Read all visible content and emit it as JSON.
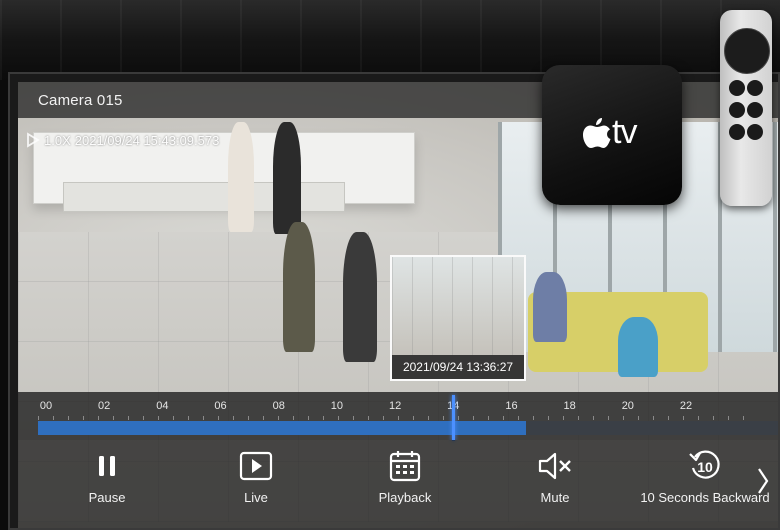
{
  "camera": {
    "title": "Camera 015",
    "osd_speed": "1.0X",
    "osd_timestamp": "2021/09/24 15:43:09.573"
  },
  "preview": {
    "timestamp": "2021/09/24 13:36:27"
  },
  "timeline": {
    "hour_labels": [
      "00",
      "02",
      "04",
      "06",
      "08",
      "10",
      "12",
      "14",
      "16",
      "18",
      "20",
      "22"
    ],
    "recorded_fraction": 0.66,
    "playhead_fraction": 0.56
  },
  "controls": {
    "pause_label": "Pause",
    "live_label": "Live",
    "playback_label": "Playback",
    "mute_label": "Mute",
    "backward_label": "10 Seconds Backward",
    "backward_icon_text": "10"
  },
  "device": {
    "logo_text": "tv"
  },
  "colors": {
    "accent": "#2f6fbf",
    "playhead": "#4c90ff"
  }
}
